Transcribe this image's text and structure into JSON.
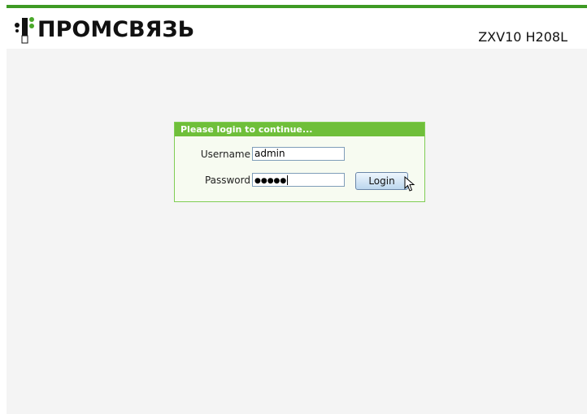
{
  "header": {
    "brand": "ПРОМСВЯЗЬ",
    "model": "ZXV10 H208L",
    "brand_color": "#3e9a24"
  },
  "login": {
    "title": "Please login to continue...",
    "username_label": "Username",
    "username_value": "admin",
    "password_label": "Password",
    "password_display": "●●●●●",
    "button_label": "Login",
    "header_color": "#6fbf3a"
  },
  "icons": {
    "logo": "promsvyaz-logo-icon",
    "cursor": "mouse-pointer-icon"
  }
}
